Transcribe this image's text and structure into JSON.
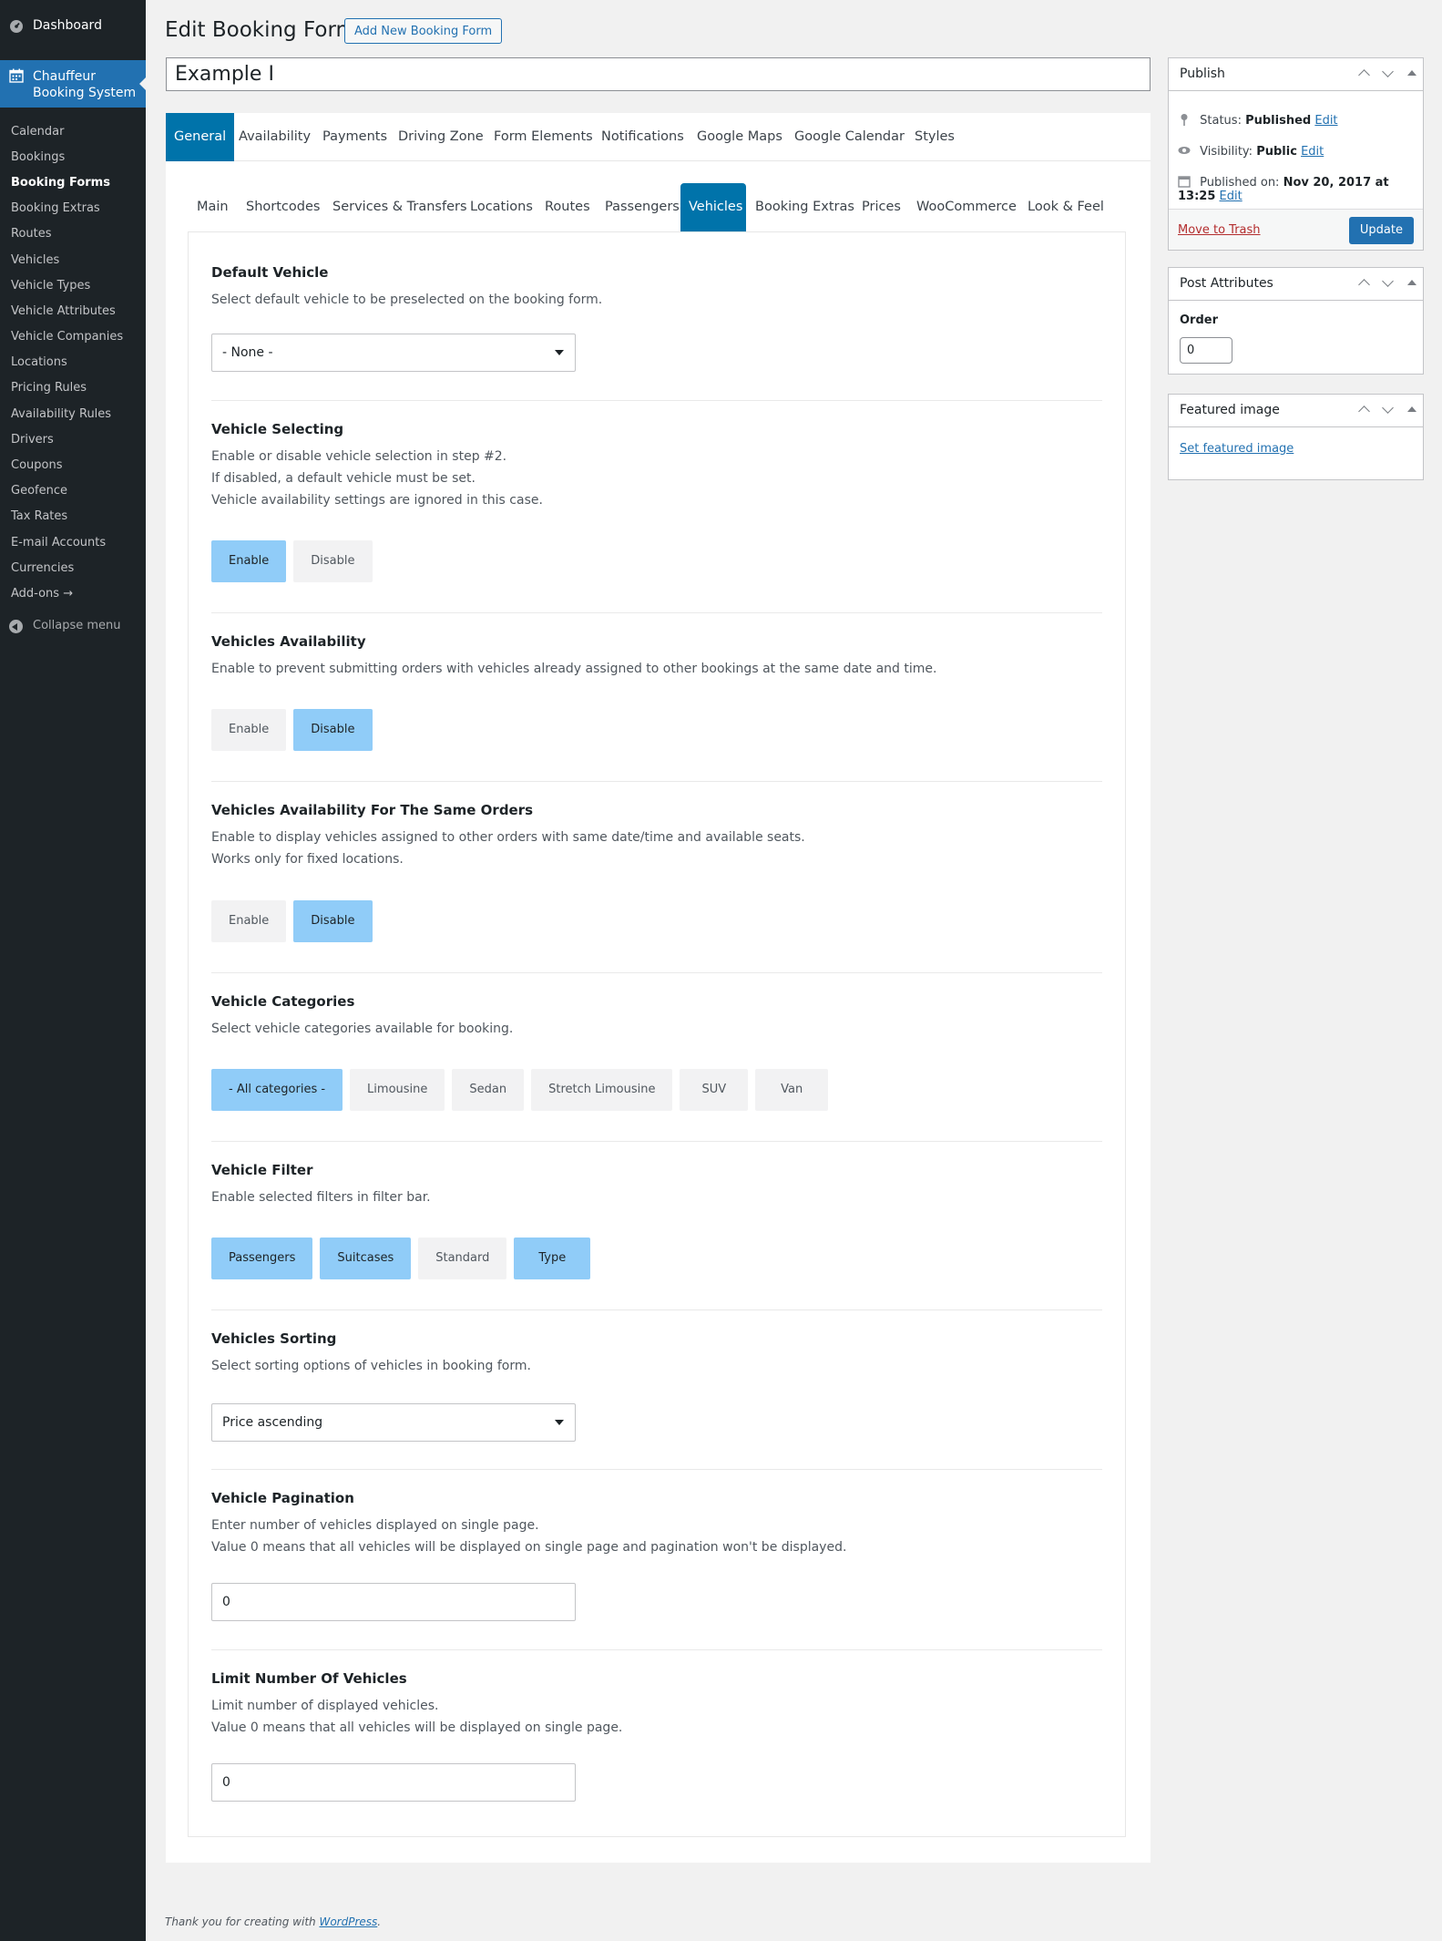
{
  "sidebar": {
    "dashboard": "Dashboard",
    "current_plugin": "Chauffeur Booking System",
    "items": [
      "Calendar",
      "Bookings",
      "Booking Forms",
      "Booking Extras",
      "Routes",
      "Vehicles",
      "Vehicle Types",
      "Vehicle Attributes",
      "Vehicle Companies",
      "Locations",
      "Pricing Rules",
      "Availability Rules",
      "Drivers",
      "Coupons",
      "Geofence",
      "Tax Rates",
      "E-mail Accounts",
      "Currencies",
      "Add-ons →"
    ],
    "active_item": "Booking Forms",
    "collapse": "Collapse menu"
  },
  "header": {
    "title": "Edit Booking Form",
    "add_new": "Add New Booking Form",
    "post_title": "Example I"
  },
  "main_tabs": [
    "General",
    "Availability",
    "Payments",
    "Driving Zone",
    "Form Elements",
    "Notifications",
    "Google Maps",
    "Google Calendar",
    "Styles"
  ],
  "main_tab_active": "General",
  "sub_tabs": [
    "Main",
    "Shortcodes",
    "Services & Transfers",
    "Locations",
    "Routes",
    "Passengers",
    "Vehicles",
    "Booking Extras",
    "Prices",
    "WooCommerce",
    "Look & Feel"
  ],
  "sub_tab_active": "Vehicles",
  "sections": {
    "default_vehicle": {
      "title": "Default Vehicle",
      "desc": "Select default vehicle to be preselected on the booking form.",
      "value": "- None -"
    },
    "vehicle_selecting": {
      "title": "Vehicle Selecting",
      "desc": [
        "Enable or disable vehicle selection in step #2.",
        "If disabled, a default vehicle must be set.",
        "Vehicle availability settings are ignored in this case."
      ],
      "enable": "Enable",
      "disable": "Disable",
      "selected": "Enable"
    },
    "vehicles_availability": {
      "title": "Vehicles Availability",
      "desc": "Enable to prevent submitting orders with vehicles already assigned to other bookings at the same date and time.",
      "enable": "Enable",
      "disable": "Disable",
      "selected": "Disable"
    },
    "availability_same_orders": {
      "title": "Vehicles Availability For The Same Orders",
      "desc": [
        "Enable to display vehicles assigned to other orders with same date/time and available seats.",
        "Works only for fixed locations."
      ],
      "enable": "Enable",
      "disable": "Disable",
      "selected": "Disable"
    },
    "vehicle_categories": {
      "title": "Vehicle Categories",
      "desc": "Select vehicle categories available for booking.",
      "options": [
        "- All categories -",
        "Limousine",
        "Sedan",
        "Stretch Limousine",
        "SUV",
        "Van"
      ],
      "selected": [
        "- All categories -"
      ]
    },
    "vehicle_filter": {
      "title": "Vehicle Filter",
      "desc": "Enable selected filters in filter bar.",
      "options": [
        "Passengers",
        "Suitcases",
        "Standard",
        "Type"
      ],
      "selected": [
        "Passengers",
        "Suitcases",
        "Type"
      ]
    },
    "vehicles_sorting": {
      "title": "Vehicles Sorting",
      "desc": "Select sorting options of vehicles in booking form.",
      "value": "Price ascending"
    },
    "vehicle_pagination": {
      "title": "Vehicle Pagination",
      "desc": [
        "Enter number of vehicles displayed on single page.",
        "Value 0 means that all vehicles will be displayed on single page and pagination won't be displayed."
      ],
      "value": "0"
    },
    "limit_vehicles": {
      "title": "Limit Number Of Vehicles",
      "desc": [
        "Limit number of displayed vehicles.",
        "Value 0 means that all vehicles will be displayed on single page."
      ],
      "value": "0"
    }
  },
  "publish": {
    "title": "Publish",
    "status_label": "Status:",
    "status": "Published",
    "visibility_label": "Visibility:",
    "visibility": "Public",
    "published_label": "Published on:",
    "published": "Nov 20, 2017 at 13:25",
    "edit": "Edit",
    "trash": "Move to Trash",
    "update": "Update"
  },
  "post_attributes": {
    "title": "Post Attributes",
    "order_label": "Order",
    "order_value": "0"
  },
  "featured_image": {
    "title": "Featured image",
    "link": "Set featured image"
  },
  "footer": {
    "text": "Thank you for creating with ",
    "link": "WordPress",
    "end": "."
  },
  "colors": {
    "sidebar_bg": "#1d2327",
    "accent": "#2271b1",
    "tab_active": "#0073aa",
    "option_on": "#90ccf8",
    "option_off": "#f2f2f3"
  }
}
